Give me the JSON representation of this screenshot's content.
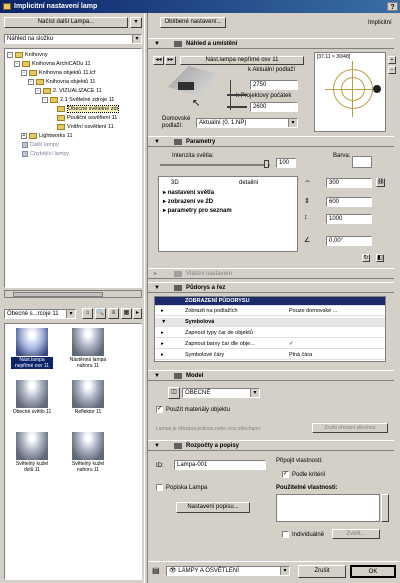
{
  "window": {
    "title": "Implicitní nastavení lamp",
    "help": "?"
  },
  "left": {
    "load_button": "Načíst další Lampa...",
    "view_select": "Náhled na složku",
    "tree": [
      {
        "label": "Knihovny",
        "level": 0,
        "kind": "folder",
        "pm": "-"
      },
      {
        "label": "Knihovna ArchiCADu 11",
        "level": 1,
        "kind": "folder",
        "pm": "-"
      },
      {
        "label": "Knihovna objektů 11.lcf",
        "level": 2,
        "kind": "folder",
        "pm": "-"
      },
      {
        "label": "Knihovna objektů 11",
        "level": 3,
        "kind": "folder",
        "pm": "-"
      },
      {
        "label": "2. VIZUALIZACE 11",
        "level": 4,
        "kind": "folder",
        "pm": "-"
      },
      {
        "label": "2.1 Světelné zdroje 11",
        "level": 5,
        "kind": "folder",
        "pm": "-"
      },
      {
        "label": "Obecné světelné zdr",
        "level": 6,
        "kind": "folder",
        "pm": "",
        "selected": true
      },
      {
        "label": "Pouliční osvětlení 11",
        "level": 6,
        "kind": "folder",
        "pm": ""
      },
      {
        "label": "Vnitřní osvětlení 11",
        "level": 6,
        "kind": "folder",
        "pm": ""
      },
      {
        "label": "Lightworks 11",
        "level": 2,
        "kind": "folder",
        "pm": "+"
      },
      {
        "label": "Další lampy",
        "level": 1,
        "kind": "lamp",
        "pm": "",
        "muted": true
      },
      {
        "label": "Chybějící lampy",
        "level": 1,
        "kind": "lamp",
        "pm": "",
        "muted": true
      }
    ],
    "folder_select": "Obecné s...rcoje 11",
    "thumbs": [
      {
        "label": "Nást.lampa nepřímé osv 11",
        "active": true
      },
      {
        "label": "Nástěnná lampa nahoru 11"
      },
      {
        "label": "Obecné světlo 11"
      },
      {
        "label": "Reflektor 11"
      },
      {
        "label": "Světelný kužel dolů 11"
      },
      {
        "label": "Světelný kužel nahoru 11"
      }
    ]
  },
  "right": {
    "favorites_button": "Oblíbené nastavení...",
    "implicit_label": "Implicitní",
    "preview": {
      "title": "Náhled a umístění",
      "object_name": "Nást.lampa nepřímé osv 11",
      "rel_floor_label": "k Aktuální podlaží",
      "rel_floor_value": "2750",
      "origin_label": "k Projektový počátek",
      "origin_value": "2600",
      "home_floor_label": "Domovské podlaží:",
      "home_floor_value": "Aktuální (0. 1.NP)",
      "symbol_caption": "[37.11 × 30/48]"
    },
    "params": {
      "title": "Parametry",
      "intensity_label": "Intenzita světla:",
      "intensity_value": "100",
      "color_label": "Barva:",
      "list_header_left": "3D",
      "list_header_right": "detailní",
      "list_items": [
        "nastavení světla",
        "zobrazení ve 2D",
        "parametry pro seznam"
      ],
      "width_value": "300",
      "depth_value": "600",
      "height_value": "1000",
      "angle_value": "0,00°",
      "extra_settings": "Vlastní nastavení"
    },
    "plan": {
      "title": "Půdorys a řez",
      "grid_header": "ZOBRAZENÍ PŮDORYSU",
      "rows": [
        {
          "label": "Zobrazit na podlažích",
          "value": "Pouze domovské ..."
        },
        {
          "label": "Symbolová",
          "value": "",
          "group": true
        },
        {
          "label": "Zapnout typy čar de objektů",
          "value": ""
        },
        {
          "label": "Zapnout barvy čar dle obje...",
          "value": "✓"
        },
        {
          "label": "Symbolové čáry",
          "value": "Plná čára"
        }
      ]
    },
    "model": {
      "title": "Model",
      "surface_select": "OBECNÉ",
      "use_materials": "Použít materiály objektu",
      "note": "Lampa je ořezána jedinou nebo více střechami.",
      "trim_button": "Zrušit ořezání střechou"
    },
    "listing": {
      "title": "Rozpočty a popisy",
      "id_label": "ID:",
      "id_value": "Lampa-001",
      "attach_label": "Připojit vlastnosti:",
      "by_class_label": "Podle kritérií",
      "caption_label": "Popiska Lampa",
      "used_props_label": "Použitelné vlastnosti:",
      "individual_label": "Individuálně",
      "caption_settings_button": "Nastavení popisu...",
      "define_button": "Zvolit..."
    },
    "layer": "LAMPY A OSVĚTLENÍ",
    "cancel_button": "Zrušit",
    "ok_button": "OK"
  }
}
